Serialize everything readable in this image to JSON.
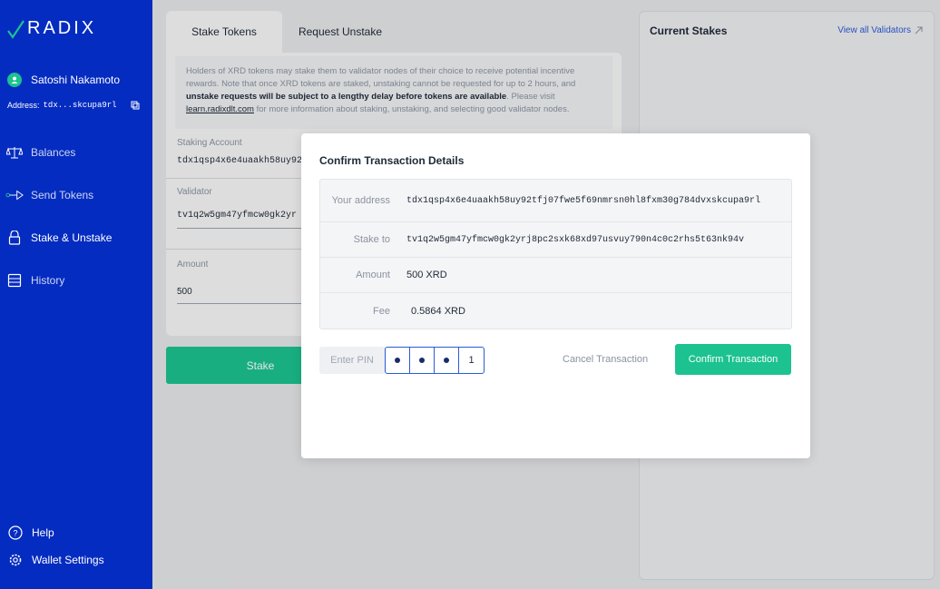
{
  "brand": {
    "logo_text": "RADIX"
  },
  "user": {
    "name": "Satoshi Nakamoto",
    "address_label": "Address:",
    "address_short": "tdx...skcupa9rl"
  },
  "nav": [
    {
      "label": "Balances",
      "icon": "scale-icon"
    },
    {
      "label": "Send Tokens",
      "icon": "send-icon"
    },
    {
      "label": "Stake & Unstake",
      "icon": "lock-icon"
    },
    {
      "label": "History",
      "icon": "history-icon"
    }
  ],
  "bottom_nav": [
    {
      "label": "Help",
      "icon": "help-icon"
    },
    {
      "label": "Wallet Settings",
      "icon": "gear-icon"
    }
  ],
  "tabs": {
    "stake": "Stake Tokens",
    "unstake": "Request Unstake"
  },
  "info": {
    "text1": "Holders of XRD tokens may stake them to validator nodes of their choice to receive potential incentive rewards. Note that once XRD tokens are staked, unstaking cannot be requested for up to 2 hours, and ",
    "bold": "unstake requests will be subject to a lengthy delay before tokens are available",
    "text2": ". Please visit ",
    "link": "learn.radixdlt.com",
    "text3": " for more information about staking, unstaking, and selecting good validator nodes."
  },
  "form": {
    "account_label": "Staking Account",
    "account_value": "tdx1qsp4x6e4uaakh58uy92",
    "validator_label": "Validator",
    "validator_value": "tv1q2w5gm47yfmcw0gk2yr",
    "amount_label": "Amount",
    "amount_value": "500",
    "stake_button": "Stake"
  },
  "right_panel": {
    "title": "Current Stakes",
    "link": "View all Validators"
  },
  "modal": {
    "title": "Confirm Transaction Details",
    "rows": [
      {
        "label": "Your address",
        "value": "tdx1qsp4x6e4uaakh58uy92tfj07fwe5f69nmrsn0hl8fxm30g784dvxskcupa9rl"
      },
      {
        "label": "Stake to",
        "value": "tv1q2w5gm47yfmcw0gk2yrj8pc2sxk68xd97usvuy790n4c0c2rhs5t63nk94v"
      },
      {
        "label": "Amount",
        "value": "500 XRD"
      },
      {
        "label": "Fee",
        "value": "0.5864 XRD"
      }
    ],
    "pin_label": "Enter PIN",
    "pin_last_digit": "1",
    "cancel": "Cancel Transaction",
    "confirm": "Confirm Transaction"
  },
  "colors": {
    "sidebar": "#052cc0",
    "accent_green": "#1cc28f",
    "link_blue": "#2b5bd7"
  }
}
